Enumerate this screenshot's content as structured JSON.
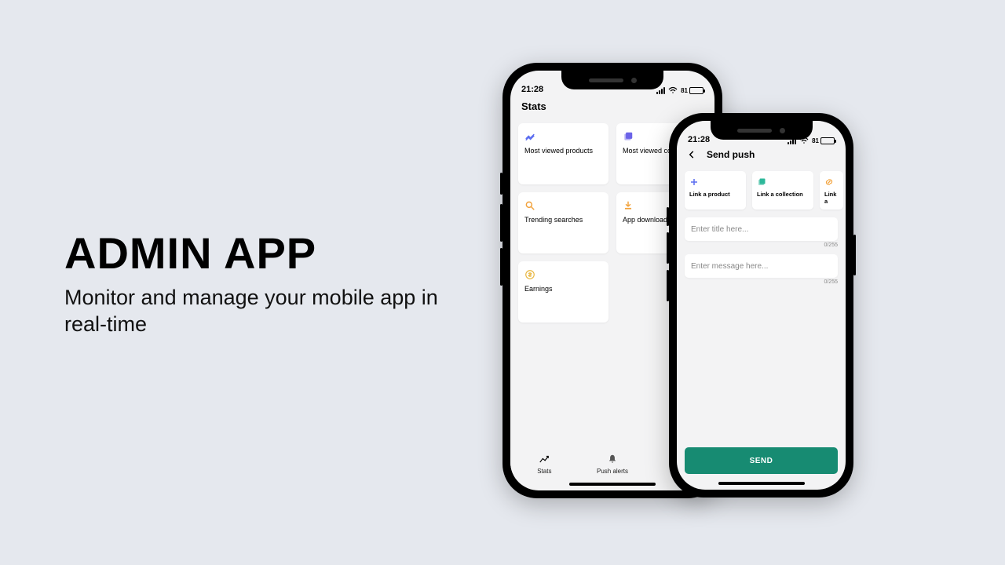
{
  "marketing": {
    "title": "ADMIN APP",
    "subtitle": "Monitor and manage your mobile app in real-time"
  },
  "phone1": {
    "status_time": "21:28",
    "battery_pct": "81",
    "screen_title": "Stats",
    "cards": [
      {
        "label": "Most viewed products"
      },
      {
        "label": "Most viewed collections"
      },
      {
        "label": "Trending searches"
      },
      {
        "label": "App downloads"
      },
      {
        "label": "Earnings"
      }
    ],
    "tabs": {
      "stats": "Stats",
      "push": "Push alerts"
    }
  },
  "phone2": {
    "status_time": "21:28",
    "battery_pct": "81",
    "screen_title": "Send push",
    "chips": [
      {
        "label": "Link a product"
      },
      {
        "label": "Link a collection"
      },
      {
        "label": "Link a"
      }
    ],
    "title_placeholder": "Enter title here...",
    "message_placeholder": "Enter message here...",
    "title_counter": "0/255",
    "message_counter": "0/255",
    "send_label": "SEND"
  }
}
